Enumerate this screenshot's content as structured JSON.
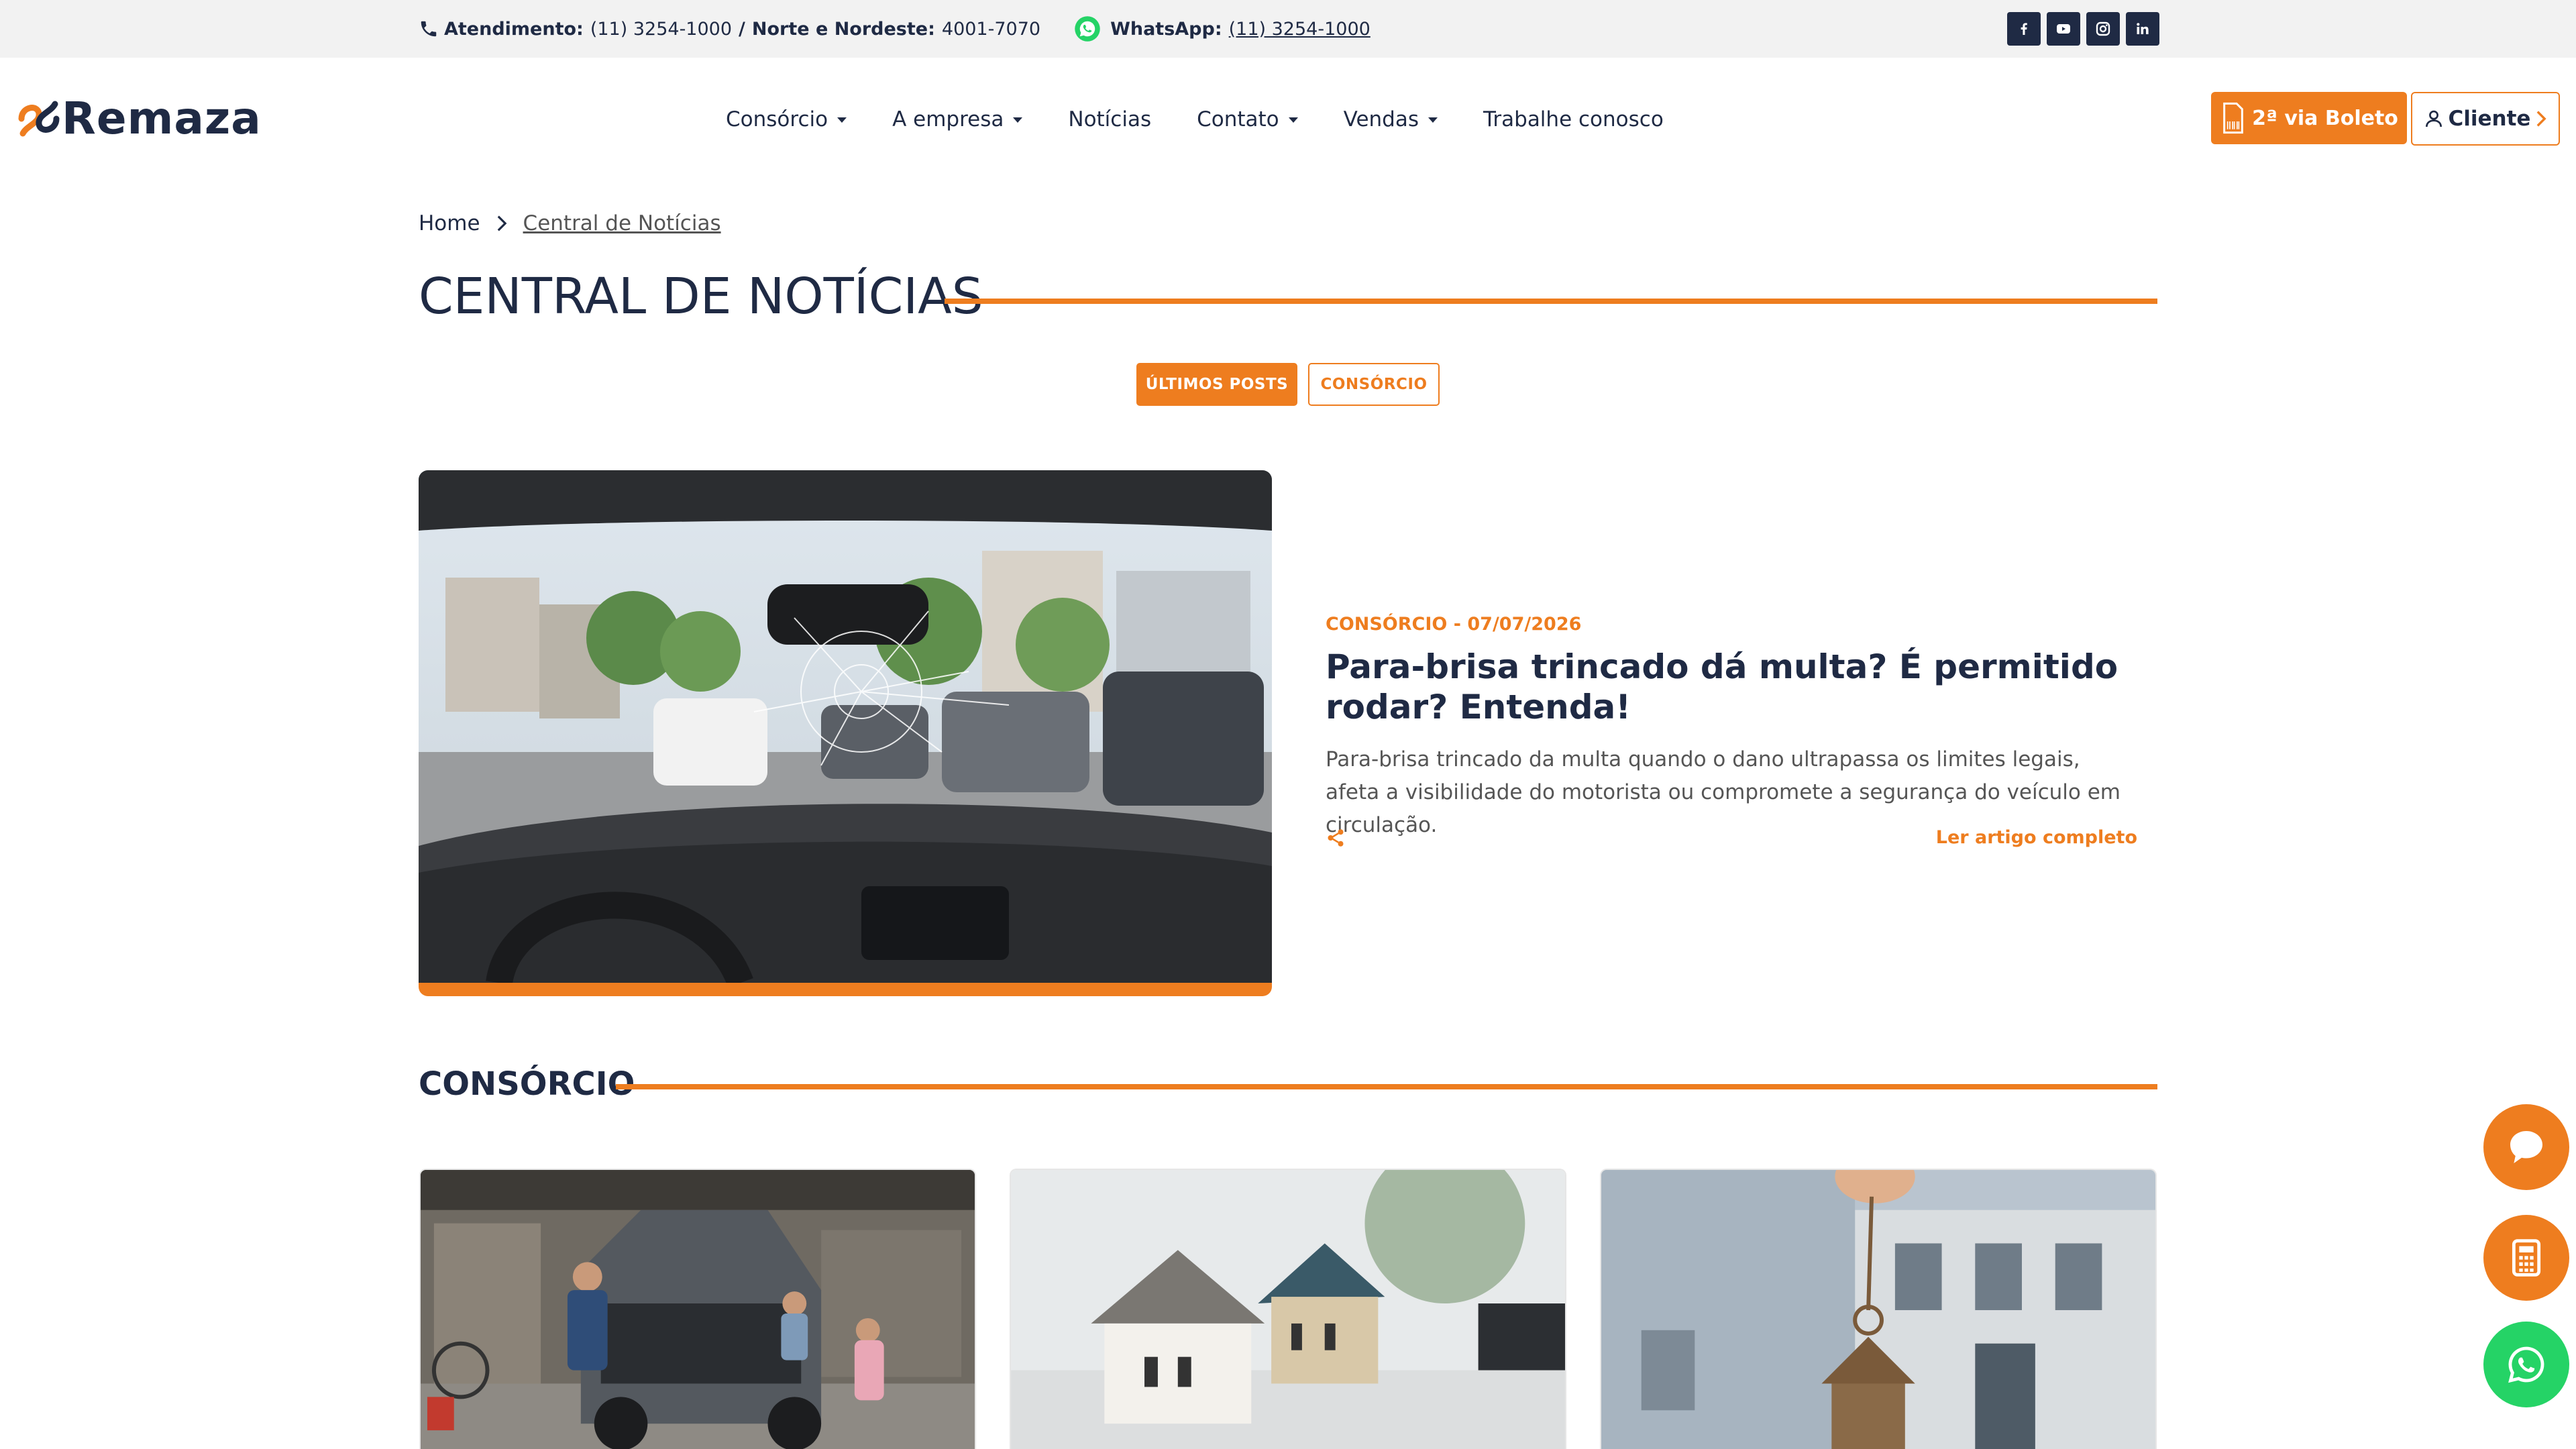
{
  "topbar": {
    "atendimento_label": "Atendimento:",
    "atendimento_phone": "(11) 3254-1000",
    "separator": "/",
    "nordeste_label": "Norte e Nordeste:",
    "nordeste_phone": "4001-7070",
    "whatsapp_label": "WhatsApp:",
    "whatsapp_phone": "(11) 3254-1000",
    "social": [
      "facebook-icon",
      "youtube-icon",
      "instagram-icon",
      "linkedin-icon"
    ]
  },
  "header": {
    "logo_text": "Remaza",
    "nav": [
      {
        "label": "Consórcio",
        "dropdown": true
      },
      {
        "label": "A empresa",
        "dropdown": true
      },
      {
        "label": "Notícias",
        "dropdown": false
      },
      {
        "label": "Contato",
        "dropdown": true
      },
      {
        "label": "Vendas",
        "dropdown": true
      },
      {
        "label": "Trabalhe conosco",
        "dropdown": false
      }
    ],
    "boleto_label": "2ª via Boleto",
    "cliente_label": "Cliente"
  },
  "breadcrumb": {
    "home": "Home",
    "current": "Central de Notícias"
  },
  "page_title": "CENTRAL DE NOTÍCIAS",
  "filters": {
    "active": "ÚLTIMOS POSTS",
    "inactive": "CONSÓRCIO"
  },
  "featured": {
    "meta": "CONSÓRCIO - 07/07/2026",
    "title": "Para-brisa trincado dá multa? É permitido rodar? Entenda!",
    "description": "Para-brisa trincado da multa quando o dano ultrapassa os limites legais, afeta a visibilidade do motorista ou compromete a segurança do veículo em circulação.",
    "read_more": "Ler artigo completo"
  },
  "section": {
    "title": "CONSÓRCIO"
  },
  "colors": {
    "accent": "#ee7d1f",
    "navy": "#1f2a44",
    "whatsapp": "#25d366"
  },
  "floating": [
    "chat-icon",
    "calculator-icon",
    "whatsapp-icon"
  ]
}
